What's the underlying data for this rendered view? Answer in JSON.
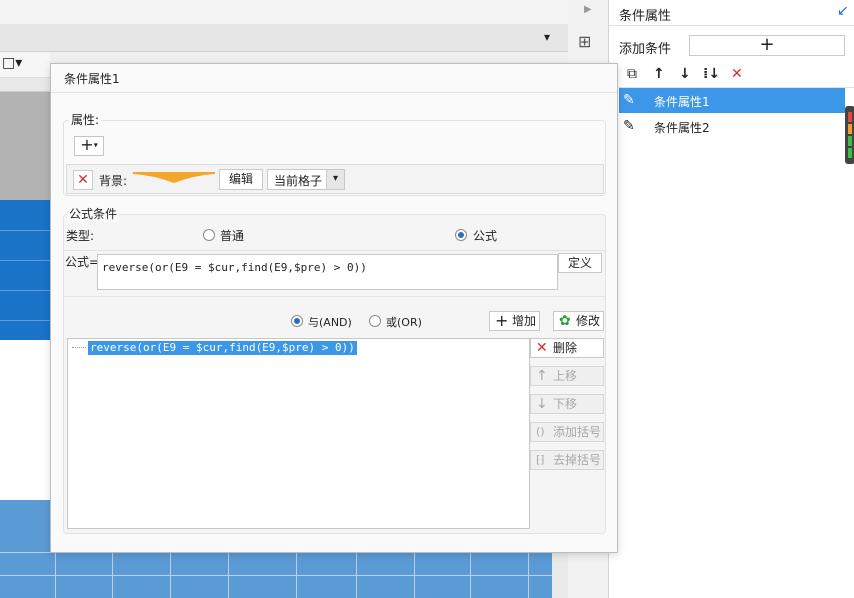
{
  "right_panel": {
    "title": "条件属性",
    "add_condition_label": "添加条件",
    "add_button_symbol": "+",
    "items": [
      {
        "label": "条件属性1",
        "selected": true
      },
      {
        "label": "条件属性2",
        "selected": false
      }
    ],
    "accent_color": "#3d97e8"
  },
  "dialog": {
    "title": "条件属性1",
    "attributes": {
      "group_label": "属性:",
      "add_symbol": "+",
      "background_label": "背景:",
      "edit_button": "编辑",
      "scope_select": "当前格子"
    },
    "formula_condition": {
      "group_label": "公式条件",
      "type_label": "类型:",
      "type_options": [
        {
          "label": "普通",
          "selected": false
        },
        {
          "label": "公式",
          "selected": true
        }
      ],
      "formula_label": "公式=",
      "formula_value": "reverse(or(E9 = $cur,find(E9,$pre) > 0))",
      "define_button": "定义",
      "logic_options": [
        {
          "label": "与(AND)",
          "selected": true
        },
        {
          "label": "或(OR)",
          "selected": false
        }
      ],
      "buttons": {
        "add": "增加",
        "modify": "修改",
        "delete": "删除",
        "move_up": "上移",
        "move_down": "下移",
        "add_bracket": "添加括号",
        "remove_bracket": "去掉括号"
      },
      "conditions": [
        "reverse(or(E9 = $cur,find(E9,$pre) > 0))"
      ]
    }
  }
}
